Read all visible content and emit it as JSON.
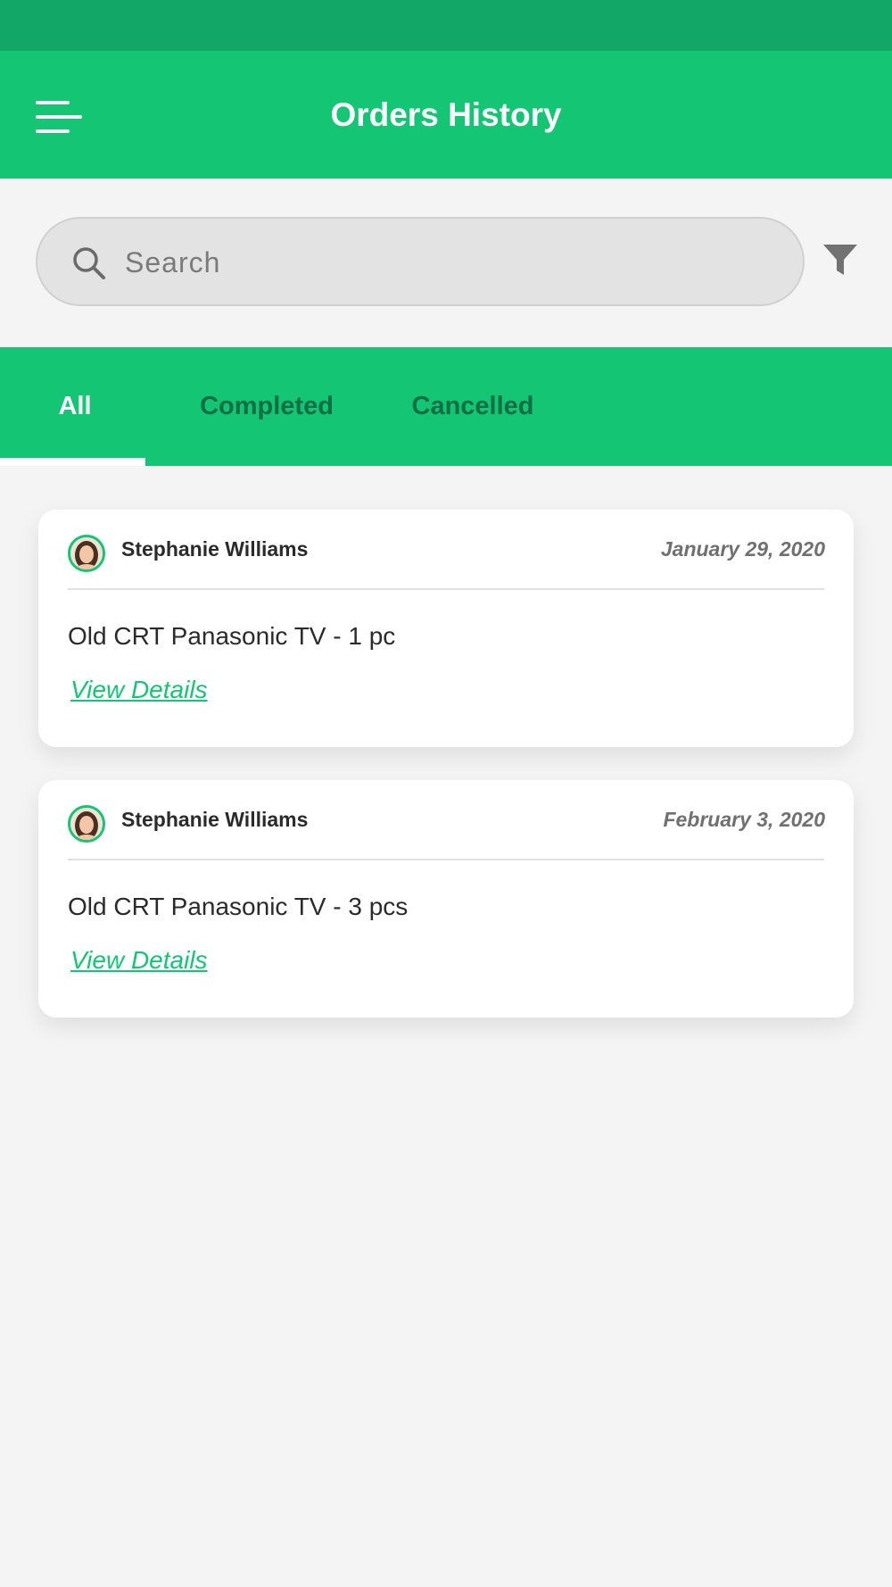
{
  "header": {
    "title": "Orders History",
    "menu_icon": "hamburger-menu-icon"
  },
  "search": {
    "placeholder": "Search",
    "value": "",
    "icon": "search-icon",
    "filter_icon": "filter-icon"
  },
  "tabs": [
    {
      "label": "All",
      "active": true
    },
    {
      "label": "Completed",
      "active": false
    },
    {
      "label": "Cancelled",
      "active": false
    }
  ],
  "orders": [
    {
      "customer": "Stephanie Williams",
      "date": "January 29, 2020",
      "item": "Old CRT Panasonic TV  - 1 pc",
      "link": "View Details"
    },
    {
      "customer": "Stephanie Williams",
      "date": "February 3, 2020",
      "item": "Old CRT Panasonic TV  - 3 pcs",
      "link": "View Details"
    }
  ],
  "colors": {
    "status_bar": "#12a667",
    "primary": "#14c574",
    "tab_inactive_text": "#0e6f45",
    "background": "#f4f4f4"
  }
}
